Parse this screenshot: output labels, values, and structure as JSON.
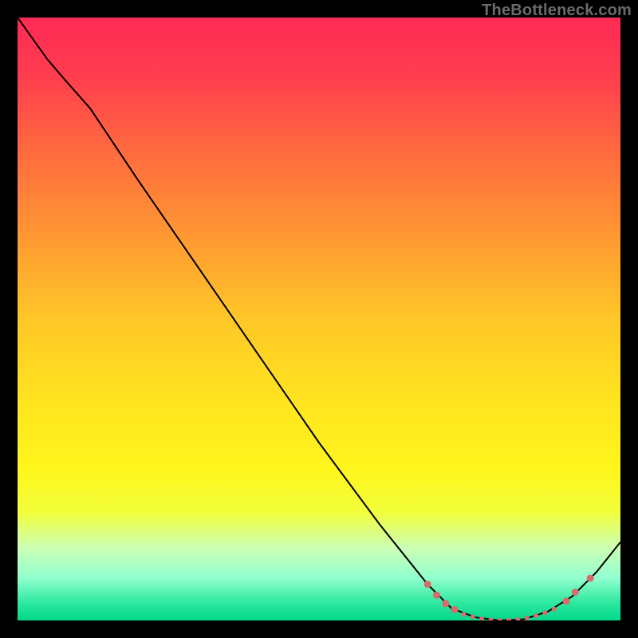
{
  "watermark": "TheBottleneck.com",
  "chart_data": {
    "type": "line",
    "title": "",
    "xlabel": "",
    "ylabel": "",
    "xlim": [
      0,
      100
    ],
    "ylim": [
      0,
      100
    ],
    "background_gradient": {
      "stops": [
        {
          "offset": 0.0,
          "color": "#ff2a55"
        },
        {
          "offset": 0.1,
          "color": "#ff3e4e"
        },
        {
          "offset": 0.22,
          "color": "#ff6a3f"
        },
        {
          "offset": 0.35,
          "color": "#ff9433"
        },
        {
          "offset": 0.5,
          "color": "#ffc727"
        },
        {
          "offset": 0.65,
          "color": "#ffe71f"
        },
        {
          "offset": 0.75,
          "color": "#fff51c"
        },
        {
          "offset": 0.82,
          "color": "#f2ff3b"
        },
        {
          "offset": 0.88,
          "color": "#ccffb5"
        },
        {
          "offset": 0.93,
          "color": "#8fffce"
        },
        {
          "offset": 0.97,
          "color": "#2fe9a0"
        },
        {
          "offset": 1.0,
          "color": "#00d88a"
        }
      ]
    },
    "series": [
      {
        "name": "bottleneck-curve",
        "color": "#000000",
        "points": [
          {
            "x": 0.0,
            "y": 100.0
          },
          {
            "x": 5.0,
            "y": 93.0
          },
          {
            "x": 8.0,
            "y": 89.5
          },
          {
            "x": 12.0,
            "y": 85.0
          },
          {
            "x": 20.0,
            "y": 73.0
          },
          {
            "x": 30.0,
            "y": 58.5
          },
          {
            "x": 40.0,
            "y": 44.0
          },
          {
            "x": 50.0,
            "y": 29.5
          },
          {
            "x": 60.0,
            "y": 16.0
          },
          {
            "x": 68.0,
            "y": 6.0
          },
          {
            "x": 72.0,
            "y": 2.0
          },
          {
            "x": 76.0,
            "y": 0.5
          },
          {
            "x": 80.0,
            "y": 0.0
          },
          {
            "x": 84.0,
            "y": 0.2
          },
          {
            "x": 88.0,
            "y": 1.5
          },
          {
            "x": 92.0,
            "y": 4.0
          },
          {
            "x": 96.0,
            "y": 8.0
          },
          {
            "x": 100.0,
            "y": 13.0
          }
        ]
      }
    ],
    "marker_series": [
      {
        "name": "range-markers",
        "color": "#d86b6b",
        "radius_major": 4.5,
        "radius_minor": 3.0,
        "points": [
          {
            "x": 68.0,
            "y": 6.0,
            "r": "major"
          },
          {
            "x": 69.5,
            "y": 4.2,
            "r": "major"
          },
          {
            "x": 71.0,
            "y": 2.8,
            "r": "major"
          },
          {
            "x": 72.5,
            "y": 1.8,
            "r": "major"
          },
          {
            "x": 74.0,
            "y": 1.0,
            "r": "minor"
          },
          {
            "x": 75.5,
            "y": 0.6,
            "r": "minor"
          },
          {
            "x": 77.0,
            "y": 0.3,
            "r": "minor"
          },
          {
            "x": 78.5,
            "y": 0.1,
            "r": "minor"
          },
          {
            "x": 80.0,
            "y": 0.0,
            "r": "minor"
          },
          {
            "x": 81.5,
            "y": 0.05,
            "r": "minor"
          },
          {
            "x": 83.0,
            "y": 0.15,
            "r": "minor"
          },
          {
            "x": 84.5,
            "y": 0.4,
            "r": "minor"
          },
          {
            "x": 86.0,
            "y": 0.8,
            "r": "minor"
          },
          {
            "x": 87.5,
            "y": 1.3,
            "r": "minor"
          },
          {
            "x": 89.0,
            "y": 1.9,
            "r": "minor"
          },
          {
            "x": 91.0,
            "y": 3.2,
            "r": "major"
          },
          {
            "x": 92.5,
            "y": 4.7,
            "r": "major"
          },
          {
            "x": 95.0,
            "y": 7.0,
            "r": "major"
          }
        ]
      }
    ]
  }
}
